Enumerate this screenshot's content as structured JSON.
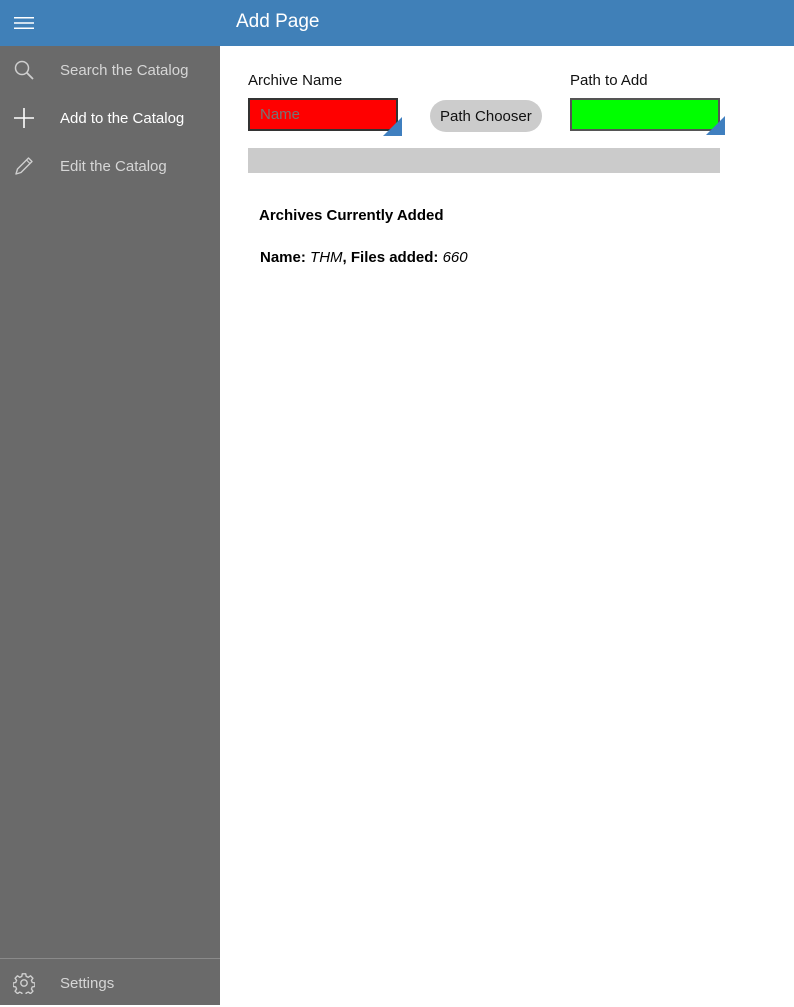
{
  "titlebar": {
    "title": "Add Page",
    "menu_icon": "hamburger-menu-icon",
    "color": "#4080b8"
  },
  "sidebar": {
    "background": "#6a6a6a",
    "items": [
      {
        "label": "Search the Catalog",
        "icon": "search-icon",
        "active": false
      },
      {
        "label": "Add to the Catalog",
        "icon": "plus-icon",
        "active": true
      },
      {
        "label": "Edit the Catalog",
        "icon": "pencil-icon",
        "active": false
      }
    ],
    "footer": {
      "label": "Settings",
      "icon": "gear-icon"
    }
  },
  "form": {
    "archive_name": {
      "label": "Archive Name",
      "placeholder": "Name",
      "value": "",
      "background": "#ff0000"
    },
    "path_chooser_label": "Path Chooser",
    "path_to_add": {
      "label": "Path to Add",
      "value": "",
      "background": "#00ff00"
    },
    "progress": 0
  },
  "archives": {
    "heading": "Archives Currently Added",
    "items": [
      {
        "name_label": "Name:",
        "name": "THM",
        "files_label": ", Files added:",
        "files": "660"
      }
    ]
  }
}
